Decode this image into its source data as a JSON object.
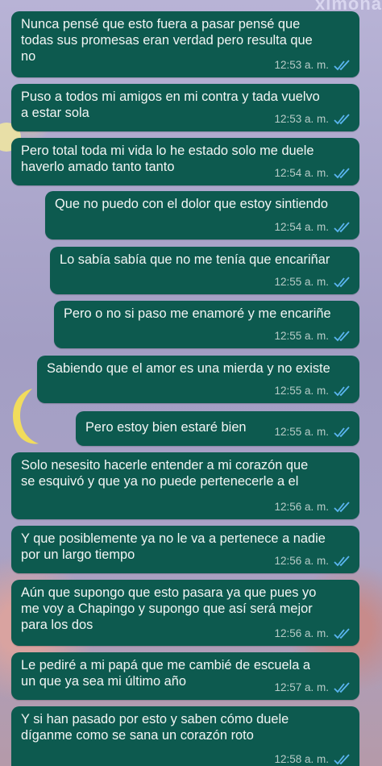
{
  "chat": {
    "watermark": "ximona",
    "tick_color": "#5ab5f0",
    "bubble_color": "#0d5a4f",
    "status_icon": "double-check-read-icon",
    "messages": [
      {
        "text": "Nunca pensé que esto fuera a pasar pensé que\ntodas sus promesas eran verdad pero resulta que\nno",
        "time": "12:53 a. m."
      },
      {
        "text": "Puso a todos mi amigos en mi contra y tada vuelvo\na estar sola",
        "time": "12:53 a. m."
      },
      {
        "text": "Pero total toda mi vida lo he estado solo me duele\nhaverlo amado tanto tanto",
        "time": "12:54 a. m."
      },
      {
        "text": "Que no puedo con el dolor que estoy sintiendo",
        "time": "12:54 a. m."
      },
      {
        "text": "Lo sabía sabía que no me tenía que encariñar",
        "time": "12:55 a. m."
      },
      {
        "text": "Pero o no si paso me enamoré y me encariñe",
        "time": "12:55 a. m."
      },
      {
        "text": "Sabiendo que el amor es una mierda y no existe",
        "time": "12:55 a. m."
      },
      {
        "text": "Pero estoy bien estaré bien",
        "time": "12:55 a. m."
      },
      {
        "text": "Solo nesesito hacerle entender a mi corazón que\nse esquivó y que ya no puede pertenecerle a el",
        "time": "12:56 a. m."
      },
      {
        "text": "Y que posiblemente ya no le va a pertenece a nadie\npor un largo tiempo",
        "time": "12:56 a. m."
      },
      {
        "text": "Aún que supongo que esto pasara ya que pues yo\nme voy a Chapingo y supongo que así será mejor\npara los dos",
        "time": "12:56 a. m."
      },
      {
        "text": "Le pediré a mi papá que me cambié de escuela a\nun que ya sea mi último año",
        "time": "12:57 a. m."
      },
      {
        "text": "Y si han pasado por esto y saben cómo duele\ndíganme como se sana un corazón roto",
        "time": "12:58 a. m."
      }
    ]
  }
}
